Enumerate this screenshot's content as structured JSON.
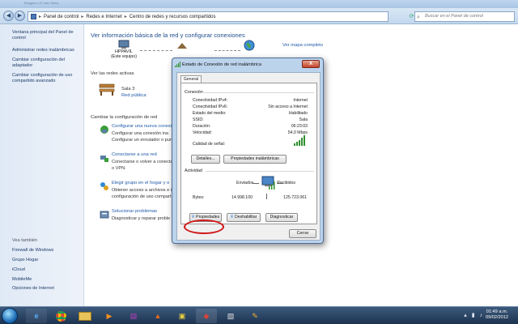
{
  "window": {
    "ghost_title": "Bloggers | El sitio Todos"
  },
  "address_bar": {
    "crumbs": [
      "Panel de control",
      "Redes e Internet",
      "Centro de redes y recursos compartidos"
    ],
    "search_placeholder": "Buscar en el Panel de control"
  },
  "sidebar": {
    "items": [
      {
        "label": "Ventana principal del Panel de control"
      },
      {
        "label": "Administrar redes inalámbricas"
      },
      {
        "label": "Cambiar configuración del adaptador"
      },
      {
        "label": "Cambiar configuración de uso compartido avanzado"
      }
    ],
    "see_also_title": "Vea también",
    "see_also": [
      {
        "label": "Firewall de Windows"
      },
      {
        "label": "Grupo Hogar"
      },
      {
        "label": "iCloud"
      },
      {
        "label": "MobileMe"
      },
      {
        "label": "Opciones de Internet"
      }
    ]
  },
  "main": {
    "title": "Ver información básica de la red y configurar conexiones",
    "full_map_link": "Ver mapa completo",
    "computer_name": "HPPAVIL",
    "computer_sub": "(Este equipo)",
    "network_name_partial": "Sala 3",
    "internet_label": "Internet",
    "active_networks_label": "Ver las redes activas",
    "network_title": "Sala 3",
    "network_type": "Red pública",
    "change_settings_label": "Cambiar la configuración de red",
    "tasks": [
      {
        "link": "Configurar una nueva conexi",
        "desc1": "Configurar una conexión ina",
        "desc2": "Configurar un enrutador o pun"
      },
      {
        "link": "Conectarse a una red",
        "desc1": "Conectarse o volver a conecta",
        "desc2": "o VPN."
      },
      {
        "link": "Elegir grupo en el hogar y o",
        "desc1": "Obtener acceso a archivos e i",
        "desc2": "configuración de uso compart"
      },
      {
        "link": "Solucionar problemas",
        "desc1": "Diagnosticar y reparar proble",
        "desc2": ""
      }
    ]
  },
  "dialog": {
    "title": "Estado de Conexión de red inalámbrica",
    "close_label": "X",
    "tab_label": "General",
    "connection_group": "Conexión",
    "rows": [
      {
        "key": "Conectividad IPv4:",
        "value": "Internet"
      },
      {
        "key": "Conectividad IPv6:",
        "value": "Sin acceso a Internet"
      },
      {
        "key": "Estado del medio:",
        "value": "Habilitado"
      },
      {
        "key": "SSID:",
        "value": "Sala"
      },
      {
        "key": "Duración:",
        "value": "06:23:03"
      },
      {
        "key": "Velocidad:",
        "value": "54,0 Mbps"
      }
    ],
    "signal_label": "Calidad de señal:",
    "details_button": "Detalles...",
    "wireless_props_button": "Propiedades inalámbricas",
    "activity_group": "Actividad",
    "sent_label": "Enviados",
    "received_label": "Recibidos",
    "bytes_label": "Bytes:",
    "bytes_sent": "14.998.100",
    "bytes_received": "125.723.061",
    "properties_button": "Propiedades",
    "disable_button": "Deshabilitar",
    "diagnose_button": "Diagnosticar",
    "close_button": "Cerrar"
  },
  "taskbar": {
    "time": "01:49 a.m.",
    "date": "09/02/2012"
  },
  "colors": {
    "link": "#1e5aa8",
    "title_blue": "#1f4f8e",
    "highlight_oval": "#d01818",
    "signal_green": "#2f8f2f"
  }
}
